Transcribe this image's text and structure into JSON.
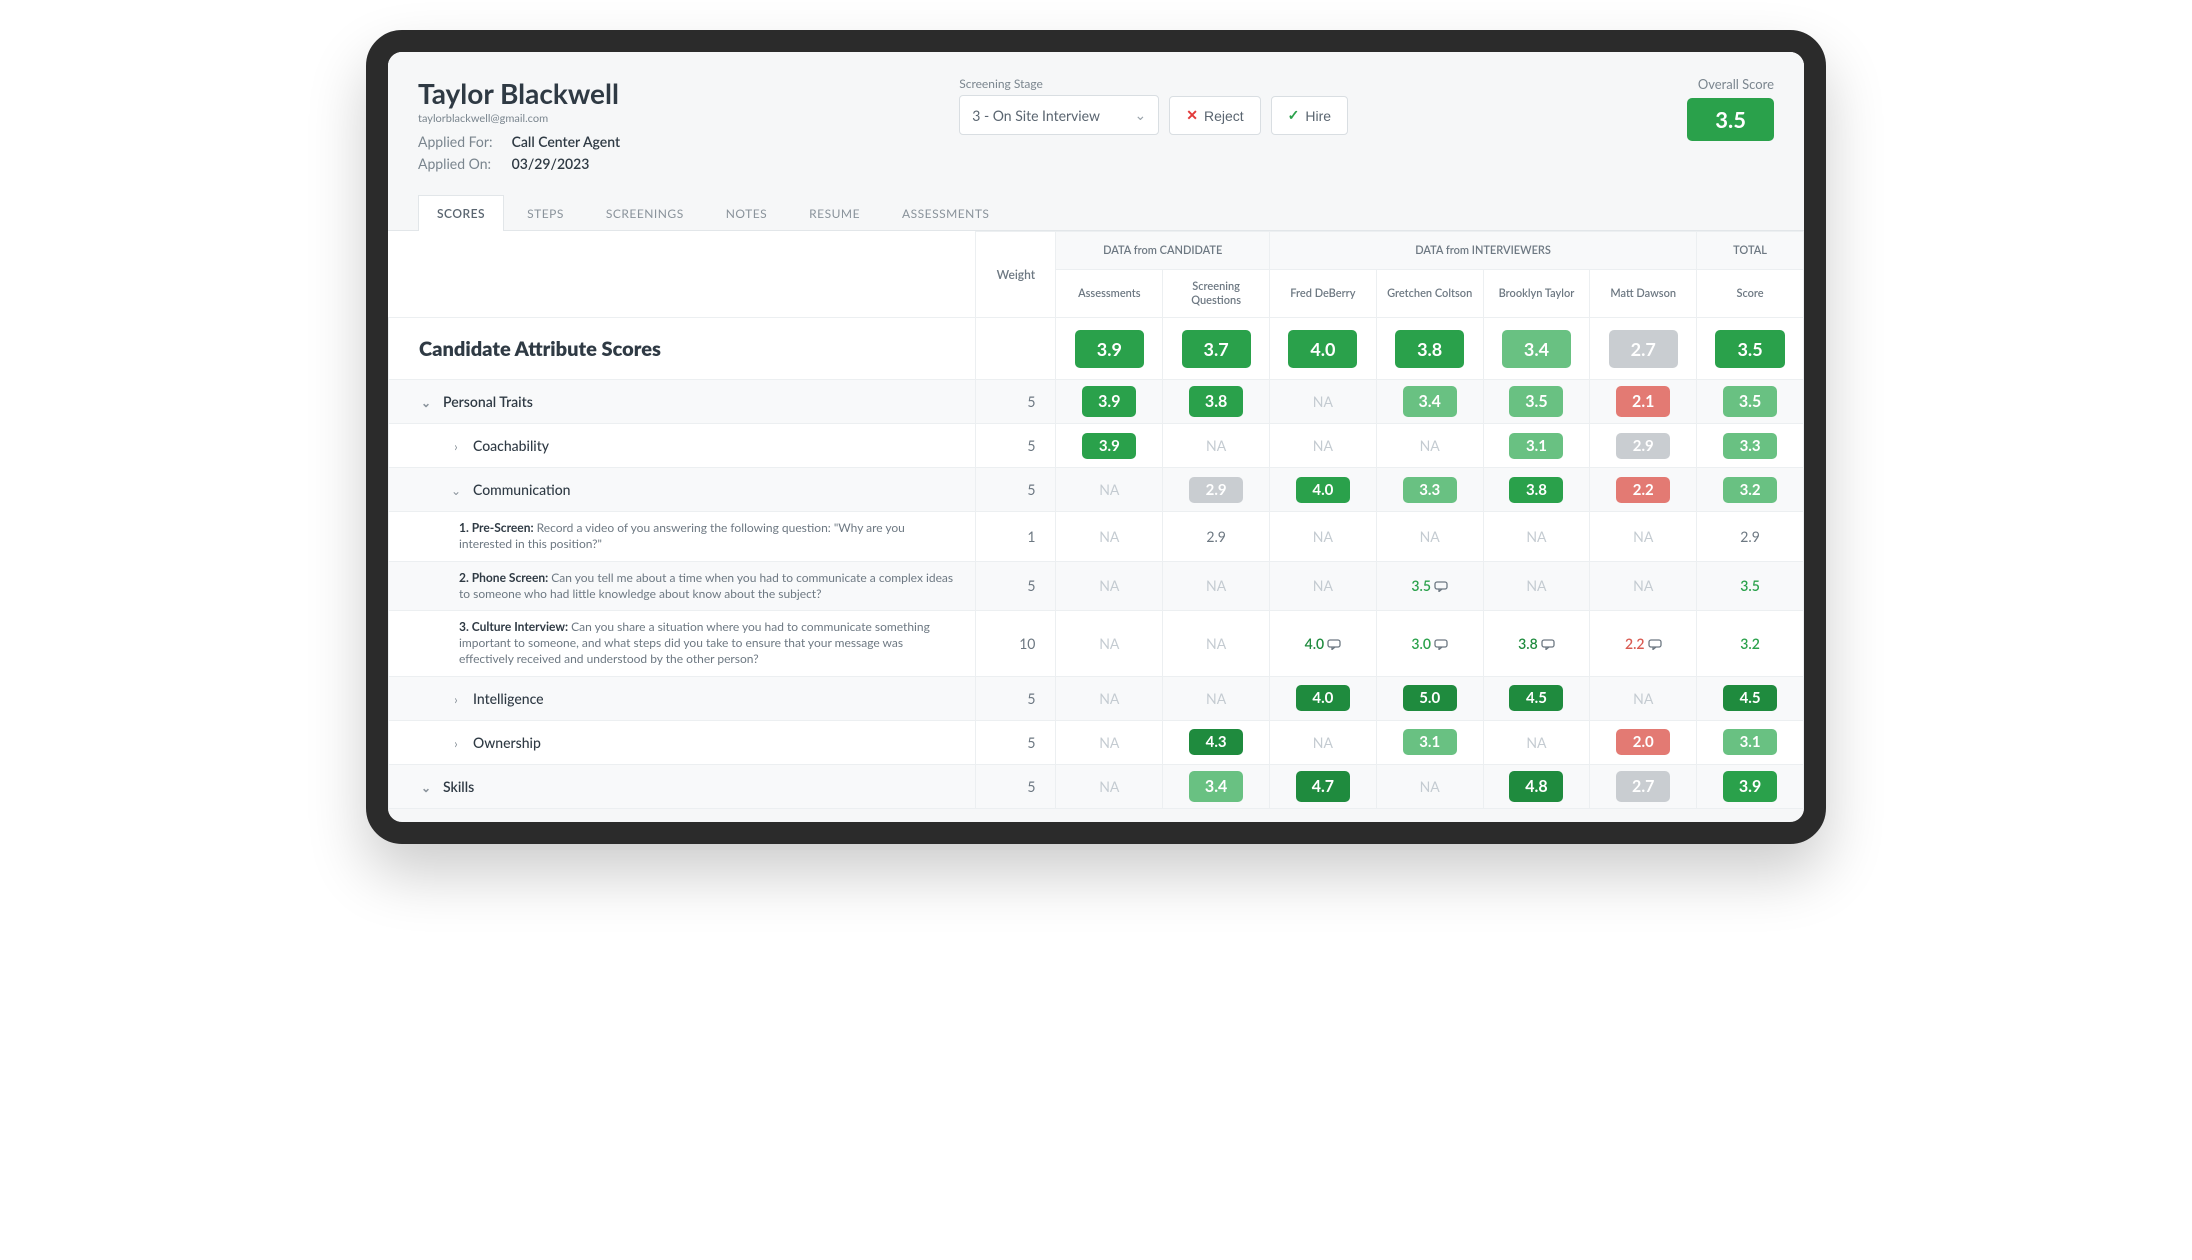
{
  "candidate": {
    "name": "Taylor Blackwell",
    "email": "taylorblackwell@gmail.com",
    "applied_for_label": "Applied For:",
    "applied_for": "Call Center Agent",
    "applied_on_label": "Applied On:",
    "applied_on": "03/29/2023"
  },
  "stage": {
    "label": "Screening Stage",
    "selected": "3 - On Site Interview"
  },
  "actions": {
    "reject": "Reject",
    "hire": "Hire"
  },
  "overall": {
    "label": "Overall Score",
    "value": "3.5"
  },
  "tabs": [
    "SCORES",
    "STEPS",
    "SCREENINGS",
    "NOTES",
    "RESUME",
    "ASSESSMENTS"
  ],
  "active_tab_index": 0,
  "columns": {
    "blank": "",
    "weight": "Weight",
    "group_candidate": "DATA from CANDIDATE",
    "group_interviewers": "DATA from INTERVIEWERS",
    "group_total": "TOTAL",
    "assessments": "Assessments",
    "screening_questions": "Screening Questions",
    "interviewers": [
      "Fred DeBerry",
      "Gretchen Coltson",
      "Brooklyn Taylor",
      "Matt Dawson"
    ],
    "score": "Score"
  },
  "section_header": {
    "title": "Candidate Attribute Scores"
  },
  "rows": [
    {
      "kind": "bigsummary",
      "label": "Candidate Attribute Scores",
      "cells": [
        {
          "v": "3.9",
          "style": "pill big green"
        },
        {
          "v": "3.7",
          "style": "pill big green"
        },
        {
          "v": "4.0",
          "style": "pill big green"
        },
        {
          "v": "3.8",
          "style": "pill big green"
        },
        {
          "v": "3.4",
          "style": "pill big lt-green"
        },
        {
          "v": "2.7",
          "style": "pill big grey"
        },
        {
          "v": "3.5",
          "style": "pill big green"
        }
      ]
    },
    {
      "kind": "toggle",
      "icon": "down",
      "label": "Personal Traits",
      "weight": "5",
      "cells": [
        {
          "v": "3.9",
          "style": "pill green"
        },
        {
          "v": "3.8",
          "style": "pill green"
        },
        {
          "v": "NA",
          "style": "na"
        },
        {
          "v": "3.4",
          "style": "pill lt-green"
        },
        {
          "v": "3.5",
          "style": "pill lt-green"
        },
        {
          "v": "2.1",
          "style": "pill red"
        },
        {
          "v": "3.5",
          "style": "pill lt-green"
        }
      ]
    },
    {
      "kind": "toggle",
      "icon": "right",
      "depth": 1,
      "label": "Coachability",
      "weight": "5",
      "cells": [
        {
          "v": "3.9",
          "style": "pill small green"
        },
        {
          "v": "NA",
          "style": "na"
        },
        {
          "v": "NA",
          "style": "na"
        },
        {
          "v": "NA",
          "style": "na"
        },
        {
          "v": "3.1",
          "style": "pill small lt-green"
        },
        {
          "v": "2.9",
          "style": "pill small grey"
        },
        {
          "v": "3.3",
          "style": "pill small lt-green"
        }
      ]
    },
    {
      "kind": "toggle",
      "icon": "down",
      "depth": 1,
      "label": "Communication",
      "weight": "5",
      "cells": [
        {
          "v": "NA",
          "style": "na"
        },
        {
          "v": "2.9",
          "style": "pill small grey"
        },
        {
          "v": "4.0",
          "style": "pill small green"
        },
        {
          "v": "3.3",
          "style": "pill small lt-green"
        },
        {
          "v": "3.8",
          "style": "pill small green"
        },
        {
          "v": "2.2",
          "style": "pill small red"
        },
        {
          "v": "3.2",
          "style": "pill small lt-green"
        }
      ]
    },
    {
      "kind": "question",
      "depth": 2,
      "step_title": "1. Pre-Screen:",
      "step_text": " Record a video of you answering the following question: \"Why are you interested in this position?\"",
      "weight": "1",
      "cells": [
        {
          "v": "NA",
          "style": "na"
        },
        {
          "v": "2.9",
          "style": "plain"
        },
        {
          "v": "NA",
          "style": "na"
        },
        {
          "v": "NA",
          "style": "na"
        },
        {
          "v": "NA",
          "style": "na"
        },
        {
          "v": "NA",
          "style": "na"
        },
        {
          "v": "2.9",
          "style": "plain"
        }
      ]
    },
    {
      "kind": "question",
      "depth": 2,
      "step_title": "2. Phone Screen:",
      "step_text": " Can you tell me about a time when you had to communicate a complex ideas to someone who had little knowledge about know about the subject?",
      "weight": "5",
      "cells": [
        {
          "v": "NA",
          "style": "na"
        },
        {
          "v": "NA",
          "style": "na"
        },
        {
          "v": "NA",
          "style": "na"
        },
        {
          "v": "3.5",
          "style": "txt-green",
          "comment": true
        },
        {
          "v": "NA",
          "style": "na"
        },
        {
          "v": "NA",
          "style": "na"
        },
        {
          "v": "3.5",
          "style": "txt-green"
        }
      ]
    },
    {
      "kind": "question",
      "depth": 2,
      "step_title": "3. Culture Interview:",
      "step_text": " Can you share a situation where you had to communicate something important to someone, and what steps did you take to ensure that your message was effectively received and understood by the other person?",
      "weight": "10",
      "cells": [
        {
          "v": "NA",
          "style": "na"
        },
        {
          "v": "NA",
          "style": "na"
        },
        {
          "v": "4.0",
          "style": "txt-dkgreen",
          "comment": true
        },
        {
          "v": "3.0",
          "style": "txt-green",
          "comment": true
        },
        {
          "v": "3.8",
          "style": "txt-dkgreen",
          "comment": true
        },
        {
          "v": "2.2",
          "style": "txt-red",
          "comment": true
        },
        {
          "v": "3.2",
          "style": "txt-green"
        }
      ]
    },
    {
      "kind": "toggle",
      "icon": "right",
      "depth": 1,
      "label": "Intelligence",
      "weight": "5",
      "cells": [
        {
          "v": "NA",
          "style": "na"
        },
        {
          "v": "NA",
          "style": "na"
        },
        {
          "v": "4.0",
          "style": "pill small dark-green"
        },
        {
          "v": "5.0",
          "style": "pill small dark-green"
        },
        {
          "v": "4.5",
          "style": "pill small dark-green"
        },
        {
          "v": "NA",
          "style": "na"
        },
        {
          "v": "4.5",
          "style": "pill small dark-green"
        }
      ]
    },
    {
      "kind": "toggle",
      "icon": "right",
      "depth": 1,
      "label": "Ownership",
      "weight": "5",
      "cells": [
        {
          "v": "NA",
          "style": "na"
        },
        {
          "v": "4.3",
          "style": "pill small dark-green"
        },
        {
          "v": "NA",
          "style": "na"
        },
        {
          "v": "3.1",
          "style": "pill small lt-green"
        },
        {
          "v": "NA",
          "style": "na"
        },
        {
          "v": "2.0",
          "style": "pill small red"
        },
        {
          "v": "3.1",
          "style": "pill small lt-green"
        }
      ]
    },
    {
      "kind": "toggle",
      "icon": "down",
      "label": "Skills",
      "weight": "5",
      "cells": [
        {
          "v": "NA",
          "style": "na"
        },
        {
          "v": "3.4",
          "style": "pill lt-green"
        },
        {
          "v": "4.7",
          "style": "pill dark-green"
        },
        {
          "v": "NA",
          "style": "na"
        },
        {
          "v": "4.8",
          "style": "pill dark-green"
        },
        {
          "v": "2.7",
          "style": "pill grey"
        },
        {
          "v": "3.9",
          "style": "pill green"
        }
      ]
    }
  ]
}
